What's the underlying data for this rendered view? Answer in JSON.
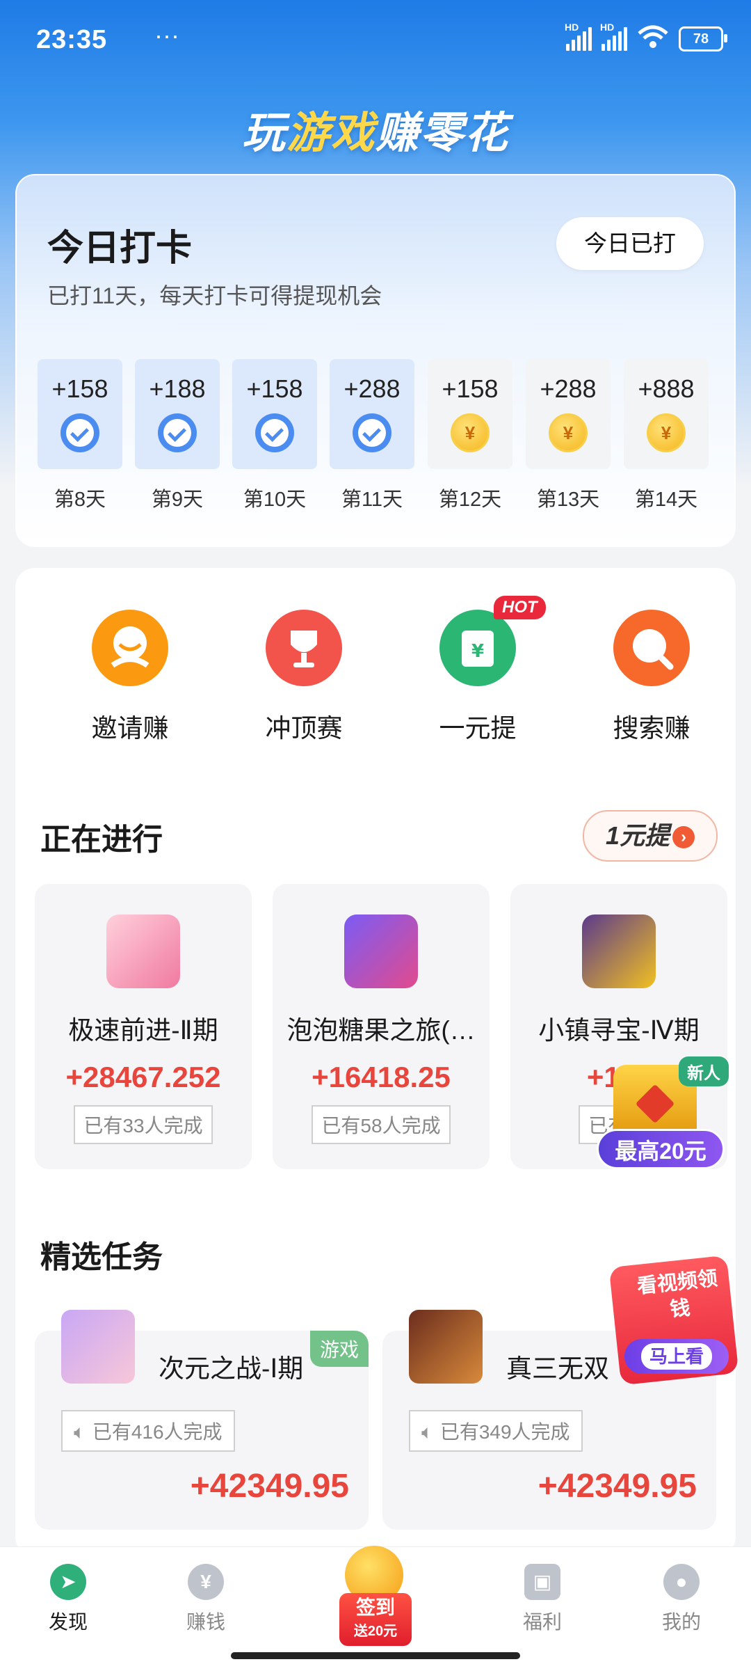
{
  "status_bar": {
    "time": "23:35",
    "dots": "···",
    "battery": "78"
  },
  "banner": {
    "part1": "玩",
    "part2": "游戏",
    "part3": "赚零花"
  },
  "checkin": {
    "title": "今日打卡",
    "subtitle": "已打11天，每天打卡可得提现机会",
    "button": "今日已打",
    "days": [
      {
        "points": "+158",
        "label": "第8天",
        "done": true
      },
      {
        "points": "+188",
        "label": "第9天",
        "done": true
      },
      {
        "points": "+158",
        "label": "第10天",
        "done": true
      },
      {
        "points": "+288",
        "label": "第11天",
        "done": true
      },
      {
        "points": "+158",
        "label": "第12天",
        "done": false
      },
      {
        "points": "+288",
        "label": "第13天",
        "done": false
      },
      {
        "points": "+888",
        "label": "第14天",
        "done": false
      }
    ]
  },
  "quick_actions": [
    {
      "label": "邀请赚",
      "color": "#fb9a10"
    },
    {
      "label": "冲顶赛",
      "color": "#f2534a"
    },
    {
      "label": "一元提",
      "color": "#2bb673",
      "badge": "HOT"
    },
    {
      "label": "搜索赚",
      "color": "#f7692a"
    }
  ],
  "ongoing": {
    "title": "正在进行",
    "pill": "1元提",
    "games": [
      {
        "name": "极速前进-Ⅱ期",
        "reward": "+28467.252",
        "done": "已有33人完成"
      },
      {
        "name": "泡泡糖果之旅(…",
        "reward": "+16418.25",
        "done": "已有58人完成"
      },
      {
        "name": "小镇寻宝-Ⅳ期",
        "reward": "+119",
        "done": "已有12"
      }
    ]
  },
  "featured": {
    "title": "精选任务",
    "tasks": [
      {
        "name": "次元之战-Ⅰ期",
        "tag": "游戏",
        "done": "已有416人完成",
        "reward": "+42349.95"
      },
      {
        "name": "真三无双",
        "tag": "",
        "done": "已有349人完成",
        "reward": "+42349.95"
      }
    ]
  },
  "float_chest": {
    "badge": "新人",
    "label": "最高20元"
  },
  "float_video": {
    "text": "看视频领钱",
    "button": "马上看"
  },
  "nav": {
    "items": [
      {
        "label": "发现"
      },
      {
        "label": "赚钱"
      },
      {
        "label": "福利"
      },
      {
        "label": "我的"
      }
    ],
    "center": {
      "line1": "签到",
      "line2": "送20元"
    }
  }
}
